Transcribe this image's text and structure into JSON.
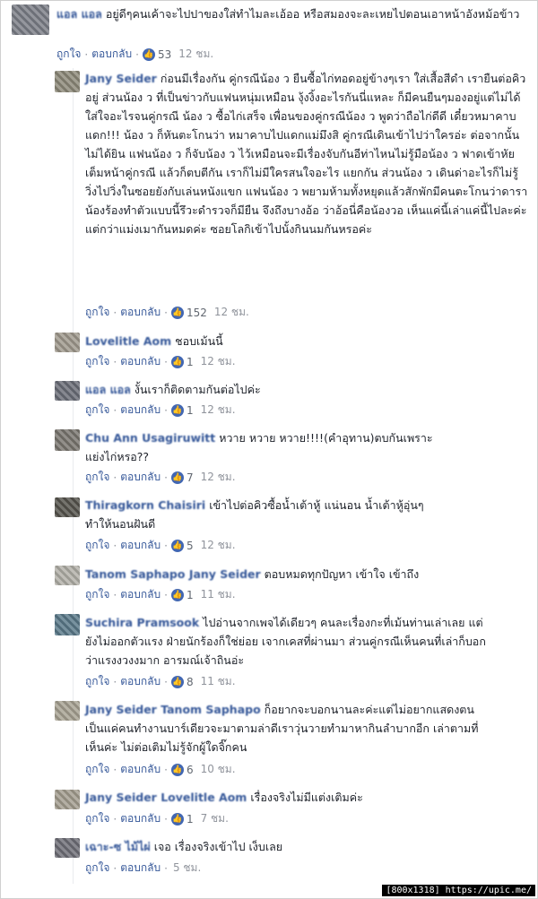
{
  "actions": {
    "like": "ถูกใจ",
    "reply": "ตอบกลับ",
    "dot": "·"
  },
  "comments": [
    {
      "name": "แอล แอล",
      "text": "อยู่ดีๆคนเค้าจะไปปาของใส่ทำไมละเอ้ออ หรือสมองจะละเหยไปตอนเอาหน้าอังหม้อข้าว",
      "likes": "53",
      "time": "12 ชม."
    },
    {
      "name": "Jany Seider",
      "text": "ก่อนมีเรื่องกัน คู่กรณีน้อง ว ยืนซื้อไก่ทอดอยู่ข้างๆเรา ใส่เสื้อสีดำ เรายืนต่อคิวอยู่ ส่วนน้อง ว ที่เป็นข่าวกับแฟนหนุ่มเหมือน งุ้งงิ้งอะไรกันนี่แหละ ก็มีคนยืนๆมองอยู่แต่ไม่ได้ใส่ใจอะไรจนคู่กรณี น้อง ว ซื้อไก่เสร็จ เพื่อนของคู่กรณีน้อง ว พูดว่าถือไก่ดีดี เดี๋ยวหมาคาบแดก!!! น้อง ว ก็หันตะโกนว่า หมาคาบไปแดกแม่มึงสิ คู่กรณีเดินเข้าไปว่าใครอ่ะ ต่อจากนั้นไม่ได้ยิน แฟนน้อง ว ก็จับน้อง ว ไว้เหมือนจะมีเรื่องจับกันอีท่าไหนไม่รู้มือน้อง ว ฟาดเข้าหัยเต็มหน้าคู่กรณี แล้วก็ตบตีกัน เราก็ไม่มีใครสนใจอะไร แยกกัน ส่วนน้อง ว เดินด่าอะไรก็ไม่รู้ วิ่งไปวิ่งในซอยยังกับเล่นหนังแขก แฟนน้อง ว พยามห้ามทั้งหยุดแล้วสักพักมีคนตะโกนว่าดาราน้องร้องทำตัวแบบนี้รึวะดำรวจก็มียืน จึงถึงบางอ้อ ว่าอ้อนี่คือน้องวอ เห็นแค่นี้เล่าแค่นี้ไปละค่ะ แต่กว่าแม่งเมากันหมดค่ะ ซอยโลกิเข้าไปนั้งกินนมกันหรอค่ะ",
      "likes": "152",
      "time": "12 ชม."
    },
    {
      "name": "Lovelitle Aom",
      "text": "ชอบเม้นนี้",
      "likes": "1",
      "time": "12 ชม."
    },
    {
      "name": "แอล แอล",
      "text": "งั้นเราก็ติดตามกันต่อไปค่ะ",
      "likes": "1",
      "time": "12 ชม."
    },
    {
      "name": "Chu Ann Usagiruwitt",
      "text": "หวาย หวาย หวาย!!!!(คำอุทาน)ตบกันเพราะแย่งไก่หรอ??",
      "likes": "7",
      "time": "12 ชม."
    },
    {
      "name": "Thiragkorn Chaisiri",
      "text": "เข้าไปต่อคิวซื้อน้ำเต้าหู้ แน่นอน น้ำเต้าหู้อุ่นๆ ทำให้นอนฝันดี",
      "likes": "5",
      "time": "12 ชม."
    },
    {
      "name": "Tanom Saphapo Jany Seider",
      "text": "ตอบหมดทุกปัญหา เข้าใจ เข้าถึง",
      "likes": "1",
      "time": "11 ชม."
    },
    {
      "name": "Suchira Pramsook",
      "text": "ไปอ่านจากเพจได้เดียวๆ คนละเรื่องกะที่เม้นท่านเล่าเลย แต่ยังไม่ออกตัวแรง ฝ่ายนักร้องก็ใช่ย่อย เจากเคสที่ผ่านมา ส่วนคู่กรณีเห็นคนที่เล่าก็บอกว่าแรงงวงงมาก อารมณ์เจ้าถินอ่ะ",
      "likes": "8",
      "time": "11 ชม."
    },
    {
      "name": "Jany Seider Tanom Saphapo",
      "text": "ก็อยากจะบอกนานละค่ะแต่ไม่อยากแสดงตน เป็นแค่คนทำงานบาร์เดียวจะมาตามล่าดีเราวุ่นวายทำมาหากินลำบากอีก เล่าตามที่เห็นค่ะ ไม่ต่อเติมไม่รู้จักผู้ใดจิ๊กคน",
      "likes": "6",
      "time": "10 ชม."
    },
    {
      "name": "Jany Seider Lovelitle Aom",
      "text": "เรื่องจริงไม่มีแต่งเติมค่ะ",
      "likes": "1",
      "time": "7 ชม."
    },
    {
      "name": "เฉาะ-ซ ไม้ไผ่",
      "text": "เจอ เรื่องจริงเข้าไป เง็บเลย",
      "likes": "",
      "time": "5 ชม."
    }
  ],
  "watermark": "[800x1318] https://upic.me/"
}
